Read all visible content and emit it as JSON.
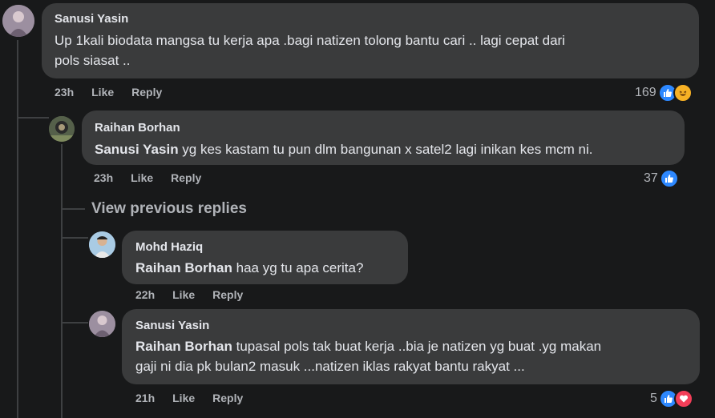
{
  "comments": [
    {
      "author": "Sanusi Yasin",
      "text_line1": "Up 1kali biodata mangsa tu kerja apa .bagi natizen tolong bantu cari .. lagi cepat dari",
      "text_line2": "pols siasat ..",
      "time": "23h",
      "like_label": "Like",
      "reply_label": "Reply",
      "reaction_count": "169",
      "reactions": [
        "like-icon",
        "haha-icon"
      ]
    },
    {
      "author": "Raihan Borhan",
      "tag": "Sanusi Yasin",
      "text": " yg kes kastam tu pun dlm bangunan x satel2 lagi inikan kes mcm ni.",
      "time": "23h",
      "like_label": "Like",
      "reply_label": "Reply",
      "reaction_count": "37",
      "reactions": [
        "like-icon"
      ]
    },
    {
      "author": "Mohd Haziq",
      "tag": "Raihan Borhan",
      "text": " haa yg tu apa cerita?",
      "time": "22h",
      "like_label": "Like",
      "reply_label": "Reply"
    },
    {
      "author": "Sanusi Yasin",
      "tag": "Raihan Borhan",
      "text_line1": " tupasal pols tak buat kerja ..bia je natizen yg buat .yg makan",
      "text_line2": "gaji ni dia pk bulan2 masuk ...natizen iklas rakyat bantu rakyat ...",
      "time": "21h",
      "like_label": "Like",
      "reply_label": "Reply",
      "reaction_count": "5",
      "reactions": [
        "like-icon",
        "love-icon"
      ]
    }
  ],
  "view_previous_replies": "View previous replies",
  "colors": {
    "background": "#18191a",
    "bubble": "#3a3b3c",
    "text": "#e4e6eb",
    "muted": "#b0b3b8",
    "like": "#2d88ff"
  }
}
